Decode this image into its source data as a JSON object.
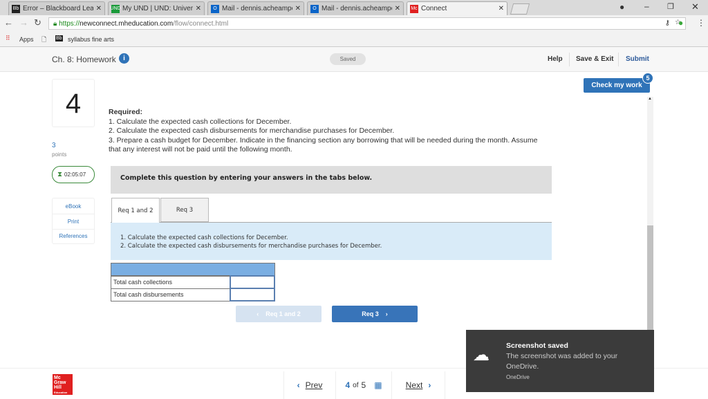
{
  "browser": {
    "tabs": [
      {
        "label": "Error – Blackboard Learn",
        "icon": "Bb",
        "color": "#222"
      },
      {
        "label": "My UND | UND: Universit",
        "icon": "UND",
        "color": "#1a9a3a"
      },
      {
        "label": "Mail - dennis.acheampon",
        "icon": "O",
        "color": "#0a64c8"
      },
      {
        "label": "Mail - dennis.acheampon",
        "icon": "O",
        "color": "#0a64c8"
      },
      {
        "label": "Connect",
        "icon": "Mc",
        "color": "#e02020"
      }
    ],
    "url_secure": "https://",
    "url_host": "newconnect.mheducation.com",
    "url_path": "/flow/connect.html",
    "bookmarks": {
      "apps": "Apps",
      "item": "syllabus fine arts"
    }
  },
  "header": {
    "title": "Ch. 8: Homework",
    "status": "Saved",
    "help": "Help",
    "save_exit": "Save & Exit",
    "submit": "Submit"
  },
  "check": {
    "label": "Check my work",
    "badge": "5"
  },
  "question": {
    "number": "4",
    "points": "3",
    "points_label": "points",
    "timer": "02:05:07",
    "required_label": "Required:",
    "lines": [
      "1. Calculate the expected cash collections for December.",
      "2. Calculate the expected cash disbursements for merchandise purchases for December.",
      "3. Prepare a cash budget for December. Indicate in the financing section any borrowing that will be needed during the month. Assume",
      "that any interest will not be paid until the following month."
    ],
    "instruction": "Complete this question by entering your answers in the tabs below."
  },
  "side_links": [
    "eBook",
    "Print",
    "References"
  ],
  "tabs": [
    "Req 1 and 2",
    "Req 3"
  ],
  "tab_content": [
    "1. Calculate the expected cash collections for December.",
    "2. Calculate the expected cash disbursements for merchandise purchases for December."
  ],
  "table": {
    "rows": [
      {
        "label": "Total cash collections",
        "value": ""
      },
      {
        "label": "Total cash disbursements",
        "value": ""
      }
    ]
  },
  "nav_buttons": {
    "prev": "Req 1 and 2",
    "next": "Req 3"
  },
  "footer": {
    "logo": "Mc Graw Hill Education",
    "prev": "Prev",
    "current": "4",
    "of": "of",
    "total": "5",
    "next": "Next"
  },
  "toast": {
    "title": "Screenshot saved",
    "body1": "The screenshot was added to your",
    "body2": "OneDrive.",
    "source": "OneDrive"
  }
}
